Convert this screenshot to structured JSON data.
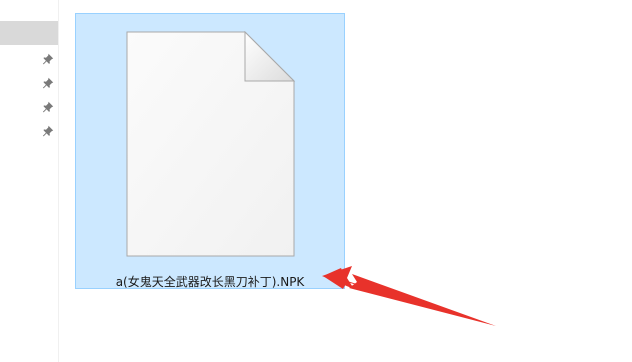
{
  "navigation": {
    "pinned_icons": [
      "pin-icon",
      "pin-icon",
      "pin-icon",
      "pin-icon"
    ]
  },
  "file": {
    "name": "a(女鬼天全武器改长黑刀补丁).NPK",
    "icon": "blank-document-icon",
    "selected": true
  },
  "annotation": {
    "icon": "red-arrow-icon",
    "color": "#e8322b"
  },
  "colors": {
    "selection_fill": "#cce8ff",
    "selection_border": "#99d1ff",
    "nav_selected": "#d9d9d9"
  }
}
